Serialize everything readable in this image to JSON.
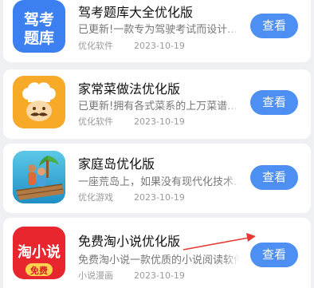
{
  "apps": [
    {
      "title": "驾考题库大全优化版",
      "desc": "已更新!一款专为驾驶考试而设计...",
      "category": "优化软件",
      "date": "2023-10-19",
      "button": "查看",
      "icon_text": "驾考题库",
      "icon_name": "exam-book-icon"
    },
    {
      "title": "家常菜做法优化版",
      "desc": "已更新!拥有各式菜系的上万菜谱...",
      "category": "优化软件",
      "date": "2023-10-19",
      "button": "查看",
      "icon_name": "chef-icon"
    },
    {
      "title": "家庭岛优化版",
      "desc": "一座荒岛上，如果没有现代化技术...",
      "category": "优化游戏",
      "date": "2023-10-19",
      "button": "查看",
      "icon_name": "island-icon"
    },
    {
      "title": "免费淘小说优化版",
      "desc": "免费淘小说一款优质的小说阅读软件",
      "category": "小说漫画",
      "date": "2023-10-19",
      "button": "查看",
      "icon_text": "淘小说",
      "icon_badge": "免费",
      "icon_name": "novel-app-icon"
    }
  ],
  "colors": {
    "button": "#4d8ff2",
    "annotation_arrow": "#e53935",
    "exam_icon": "#3c7ff0",
    "chef_icon": "#f7a928",
    "novel_icon": "#e8262e"
  }
}
